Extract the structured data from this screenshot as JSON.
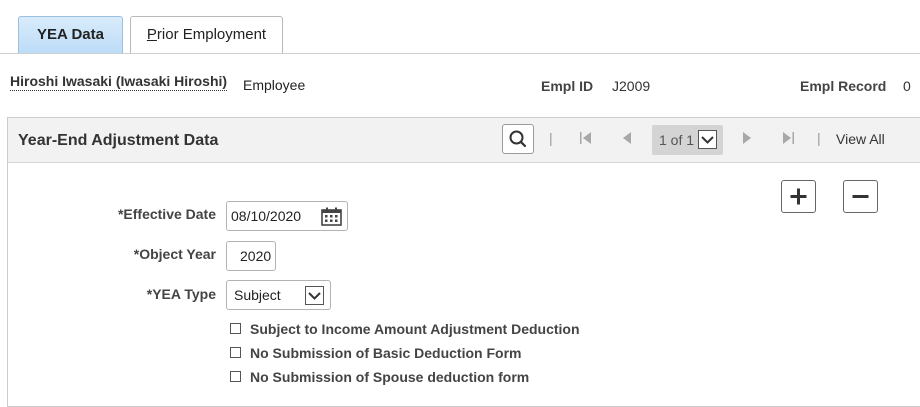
{
  "tabs": [
    {
      "label": "YEA Data",
      "active": true
    },
    {
      "label_first": "P",
      "label_rest": "rior Employment",
      "active": false
    }
  ],
  "employee": {
    "name": "Hiroshi Iwasaki (Iwasaki Hiroshi)",
    "type": "Employee",
    "empl_id_label": "Empl ID",
    "empl_id": "J2009",
    "empl_record_label": "Empl Record",
    "empl_record": "0"
  },
  "group": {
    "title": "Year-End Adjustment Data",
    "pager": "1 of 1",
    "view_all": "View All",
    "icons": {
      "search": "search-icon",
      "first": "first-page-icon",
      "prev": "previous-icon",
      "next": "next-icon",
      "last": "last-page-icon",
      "add": "plus-icon",
      "delete": "minus-icon"
    }
  },
  "form": {
    "effective_date_label": "*Effective Date",
    "effective_date": "08/10/2020",
    "object_year_label": "*Object Year",
    "object_year": "2020",
    "yea_type_label": "*YEA Type",
    "yea_type": "Subject",
    "checkboxes": [
      {
        "label": "Subject to Income Amount Adjustment Deduction",
        "checked": false
      },
      {
        "label": "No Submission of Basic Deduction Form",
        "checked": false
      },
      {
        "label": "No Submission of Spouse deduction form",
        "checked": false
      }
    ]
  }
}
